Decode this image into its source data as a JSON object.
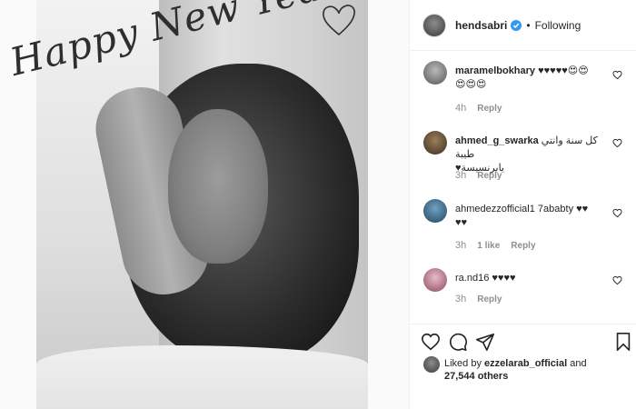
{
  "post": {
    "greeting": "Happy New Year",
    "image_subject": "black-and-white portrait photo"
  },
  "header": {
    "username": "hendsabri",
    "separator": "•",
    "follow_status": "Following"
  },
  "comments": [
    {
      "username": "maramelbokhary",
      "text": "♥♥♥♥♥😍😍",
      "text2": "😍😍😍",
      "time": "4h",
      "likes": "",
      "reply": "Reply"
    },
    {
      "username": "ahmed_g_swarka",
      "text": "كل سنة وانتي طيبة",
      "text2": "يابرنسيسة♥",
      "time": "3h",
      "likes": "",
      "reply": "Reply"
    },
    {
      "username": "ahmedezzofficial1",
      "text": "7ababty ♥♥",
      "text2": "♥♥",
      "time": "3h",
      "likes": "1 like",
      "reply": "Reply"
    },
    {
      "username": "ra.nd16",
      "text": "♥♥♥♥",
      "text2": "",
      "time": "3h",
      "likes": "",
      "reply": "Reply"
    }
  ],
  "actions": {
    "icons": [
      "heart-icon",
      "comment-icon",
      "share-icon",
      "bookmark-icon"
    ]
  },
  "liked_by": {
    "prefix": "Liked by",
    "user": "ezzelarab_official",
    "conjunction": "and",
    "count": "27,544 others"
  }
}
